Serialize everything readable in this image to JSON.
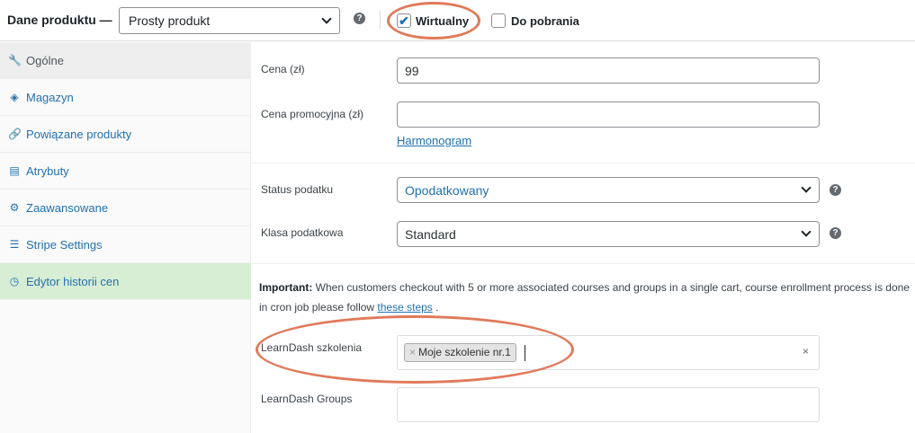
{
  "header": {
    "title": "Dane produktu —",
    "product_type": "Prosty produkt",
    "help_glyph": "?",
    "virtual_label": "Wirtualny",
    "virtual_checked": true,
    "downloadable_label": "Do pobrania",
    "downloadable_checked": false,
    "check_glyph": "✔"
  },
  "sidebar": {
    "items": [
      {
        "label": "Ogólne",
        "icon": "wrench-icon",
        "glyph": "🔧"
      },
      {
        "label": "Magazyn",
        "icon": "tag-icon",
        "glyph": "◈"
      },
      {
        "label": "Powiązane produkty",
        "icon": "link-icon",
        "glyph": "🔗"
      },
      {
        "label": "Atrybuty",
        "icon": "table-icon",
        "glyph": "▤"
      },
      {
        "label": "Zaawansowane",
        "icon": "gear-icon",
        "glyph": "⚙"
      },
      {
        "label": "Stripe Settings",
        "icon": "list-icon",
        "glyph": "☰"
      },
      {
        "label": "Edytor historii cen",
        "icon": "history-icon",
        "glyph": "◷"
      }
    ]
  },
  "general": {
    "price_label": "Cena (zł)",
    "price_value": "99",
    "sale_price_label": "Cena promocyjna (zł)",
    "sale_price_value": "",
    "schedule_link": "Harmonogram",
    "tax_status_label": "Status podatku",
    "tax_status_value": "Opodatkowany",
    "tax_class_label": "Klasa podatkowa",
    "tax_class_value": "Standard"
  },
  "notice": {
    "bold": "Important:",
    "text": " When customers checkout with 5 or more associated courses and groups in a single cart, course enrollment process is done in cron job please follow ",
    "link": "these steps",
    "end": " ."
  },
  "learndash": {
    "courses_label": "LearnDash szkolenia",
    "selected_course": "Moje szkolenie nr.1",
    "remove_glyph": "×",
    "clear_glyph": "×",
    "groups_label": "LearnDash Groups"
  },
  "colors": {
    "accent": "#2271b1",
    "annotation": "#e07a5a",
    "active_tab_bg": "#eeeeee",
    "highlight_tab_bg": "#d7eed4"
  }
}
